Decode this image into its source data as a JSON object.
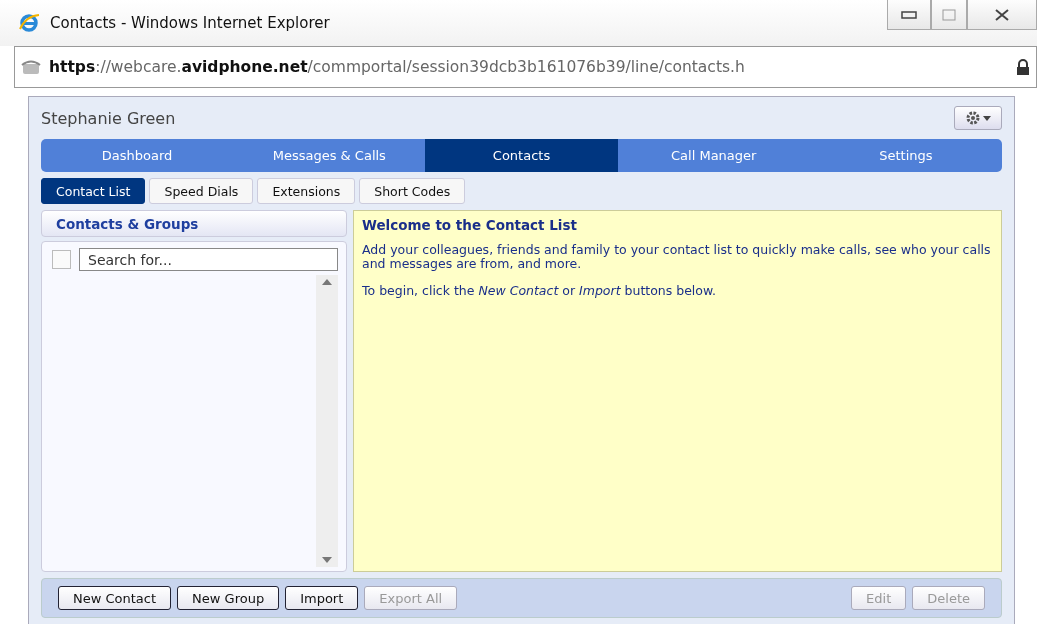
{
  "window": {
    "title": "Contacts - Windows Internet Explorer"
  },
  "address_bar": {
    "url": "**https**://webcare.**avidphone.net**/commportal/session39dcb3b161076b39/line/contacts.h"
  },
  "user": {
    "name": "Stephanie Green"
  },
  "nav_tabs": [
    {
      "label": "Dashboard",
      "selected": false
    },
    {
      "label": "Messages & Calls",
      "selected": false
    },
    {
      "label": "Contacts",
      "selected": true
    },
    {
      "label": "Call Manager",
      "selected": false
    },
    {
      "label": "Settings",
      "selected": false
    }
  ],
  "sub_tabs": [
    {
      "label": "Contact List",
      "selected": true
    },
    {
      "label": "Speed Dials",
      "selected": false
    },
    {
      "label": "Extensions",
      "selected": false
    },
    {
      "label": "Short Codes",
      "selected": false
    }
  ],
  "sidebar": {
    "title": "Contacts & Groups",
    "select_all_checked": false,
    "search": {
      "placeholder": "Search for..."
    }
  },
  "welcome": {
    "title": "Welcome to the Contact List",
    "paragraphs": [
      "Add your colleagues, friends and family to your contact list to quickly make calls, see who your calls and messages are from, and more.",
      "To begin, click the *New Contact* or *Import* buttons below."
    ]
  },
  "buttons_left": [
    {
      "label": "New Contact",
      "disabled": false
    },
    {
      "label": "New Group",
      "disabled": false
    },
    {
      "label": "Import",
      "disabled": false
    },
    {
      "label": "Export All",
      "disabled": true
    }
  ],
  "buttons_right": [
    {
      "label": "Edit",
      "disabled": true
    },
    {
      "label": "Delete",
      "disabled": true
    }
  ]
}
